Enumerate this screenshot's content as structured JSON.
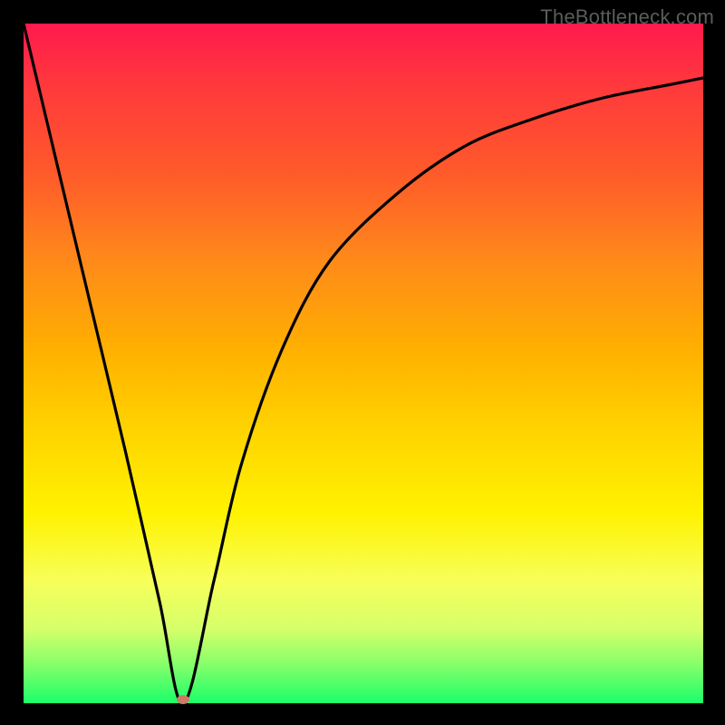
{
  "watermark": "TheBottleneck.com",
  "marker": {
    "x_frac": 0.235,
    "y_frac": 0.995,
    "color": "#cc7a66"
  },
  "chart_data": {
    "type": "line",
    "title": "",
    "xlabel": "",
    "ylabel": "",
    "xlim": [
      0,
      1
    ],
    "ylim": [
      0,
      1
    ],
    "note": "y measured from bottom (0) to top (1). Curve depicts a V-shaped bottleneck profile dipping to ~0 near x≈0.235 then rising asymptotically.",
    "series": [
      {
        "name": "bottleneck-curve",
        "x": [
          0.0,
          0.05,
          0.1,
          0.15,
          0.2,
          0.235,
          0.28,
          0.32,
          0.38,
          0.45,
          0.55,
          0.65,
          0.75,
          0.85,
          0.95,
          1.0
        ],
        "y": [
          1.0,
          0.79,
          0.58,
          0.37,
          0.15,
          0.0,
          0.18,
          0.35,
          0.52,
          0.65,
          0.75,
          0.82,
          0.86,
          0.89,
          0.91,
          0.92
        ]
      }
    ],
    "marker_point": {
      "x": 0.235,
      "y": 0.005
    },
    "gradient_stops": [
      {
        "pos": 0.0,
        "color": "#ff1a4d"
      },
      {
        "pos": 0.1,
        "color": "#ff3b3b"
      },
      {
        "pos": 0.22,
        "color": "#ff5a2a"
      },
      {
        "pos": 0.35,
        "color": "#ff8a1a"
      },
      {
        "pos": 0.48,
        "color": "#ffb000"
      },
      {
        "pos": 0.6,
        "color": "#ffd400"
      },
      {
        "pos": 0.72,
        "color": "#fff200"
      },
      {
        "pos": 0.82,
        "color": "#f7ff5a"
      },
      {
        "pos": 0.89,
        "color": "#d6ff6a"
      },
      {
        "pos": 0.94,
        "color": "#8bff6a"
      },
      {
        "pos": 1.0,
        "color": "#1aff6a"
      }
    ]
  }
}
